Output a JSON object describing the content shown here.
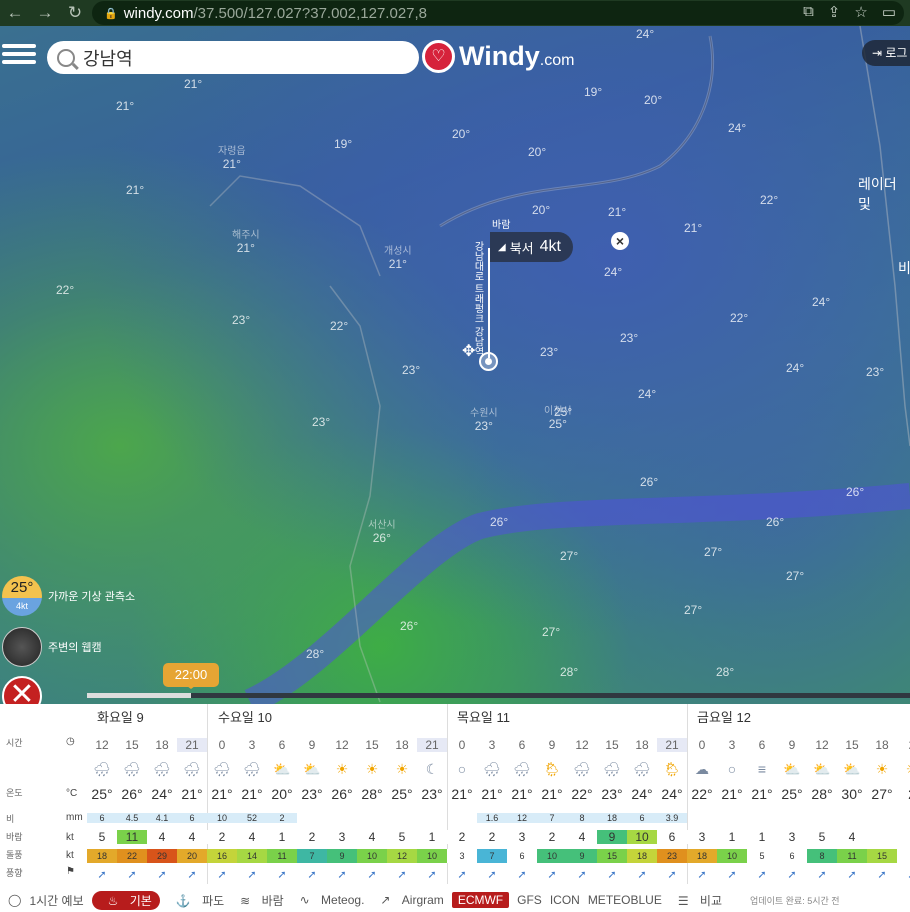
{
  "browser": {
    "url_domain": "windy.com",
    "url_path": "/37.500/127.027?37.002,127.027,8"
  },
  "search": {
    "value": "강남역"
  },
  "logo": {
    "brand": "Windy",
    "suffix": ".com"
  },
  "login": {
    "label": "로그"
  },
  "map": {
    "labels": [
      {
        "name": "",
        "temp": "24°"
      },
      {
        "name": "",
        "temp": "21°"
      },
      {
        "name": "",
        "temp": "21°"
      },
      {
        "name": "자령읍",
        "temp": "21°"
      },
      {
        "name": "",
        "temp": "21°"
      },
      {
        "name": "해주시",
        "temp": "21°"
      },
      {
        "name": "개성시",
        "temp": "21°"
      },
      {
        "name": "",
        "temp": "19°"
      },
      {
        "name": "",
        "temp": "20°"
      },
      {
        "name": "",
        "temp": "20°"
      },
      {
        "name": "",
        "temp": "20°"
      },
      {
        "name": "",
        "temp": "19°"
      },
      {
        "name": "",
        "temp": "20°"
      },
      {
        "name": "",
        "temp": "21°"
      },
      {
        "name": "",
        "temp": "24°"
      },
      {
        "name": "",
        "temp": "21°"
      },
      {
        "name": "",
        "temp": "22°"
      },
      {
        "name": "",
        "temp": "24°"
      },
      {
        "name": "",
        "temp": "22°"
      },
      {
        "name": "",
        "temp": "24°"
      },
      {
        "name": "",
        "temp": "23°"
      },
      {
        "name": "",
        "temp": "22°"
      },
      {
        "name": "",
        "temp": "23°"
      },
      {
        "name": "",
        "temp": "23°"
      },
      {
        "name": "",
        "temp": "25°"
      },
      {
        "name": "",
        "temp": "24°"
      },
      {
        "name": "",
        "temp": "23°"
      },
      {
        "name": "수원시",
        "temp": "23°"
      },
      {
        "name": "이천시",
        "temp": "25°"
      },
      {
        "name": "",
        "temp": "24°"
      },
      {
        "name": "",
        "temp": "23°"
      },
      {
        "name": "서산시",
        "temp": "26°"
      },
      {
        "name": "",
        "temp": "26°"
      },
      {
        "name": "",
        "temp": "26°"
      },
      {
        "name": "",
        "temp": "26°"
      },
      {
        "name": "",
        "temp": "27°"
      },
      {
        "name": "",
        "temp": "27°"
      },
      {
        "name": "",
        "temp": "26°"
      },
      {
        "name": "",
        "temp": "27°"
      },
      {
        "name": "",
        "temp": "28°"
      },
      {
        "name": "",
        "temp": "27°"
      },
      {
        "name": "",
        "temp": "28°"
      },
      {
        "name": "",
        "temp": "28°"
      },
      {
        "name": "",
        "temp": "27°"
      },
      {
        "name": "",
        "temp": "26°"
      },
      {
        "name": "",
        "temp": "23°"
      },
      {
        "name": "",
        "temp": "22°"
      }
    ],
    "radar_label": "레이더 및",
    "radar_label2": "비",
    "wind_tag": {
      "title": "바람",
      "direction": "북서",
      "speed": "4kt"
    },
    "pin_label": "강남대로 트래펑크 강남역",
    "station": {
      "temp": "25°",
      "wind": "4kt",
      "label": "가까운 기상 관측소"
    },
    "webcam": {
      "label": "주변의 웹캠"
    },
    "time_bubble": "22:00"
  },
  "forecast": {
    "days": [
      "화요일 9",
      "수요일 10",
      "목요일 11",
      "금요일 12"
    ],
    "row_labels": {
      "time": "시간",
      "temp": "온도",
      "rain": "비",
      "wind": "바람",
      "gust": "돌풍",
      "dir": "풍향"
    },
    "units": {
      "temp": "°C",
      "rain": "mm",
      "wind": "kt",
      "gust": "kt"
    },
    "hours": [
      "12",
      "15",
      "18",
      "21",
      "0",
      "3",
      "6",
      "9",
      "12",
      "15",
      "18",
      "21",
      "0",
      "3",
      "6",
      "9",
      "12",
      "15",
      "18",
      "21",
      "0",
      "3",
      "6",
      "9",
      "12",
      "15",
      "18",
      "2"
    ],
    "icons": [
      "rain",
      "rain",
      "rain",
      "rain",
      "rain",
      "rain",
      "sun-cloud",
      "sun-cloud",
      "sun",
      "sun",
      "sun",
      "moon",
      "moon-clear",
      "rain",
      "rain",
      "rain-sun",
      "rain",
      "rain",
      "rain",
      "rain-sun",
      "cloud-moon",
      "moon-clear",
      "fog",
      "sun-cloud",
      "sun-cloud",
      "sun-cloud",
      "sun",
      "sun"
    ],
    "temps": [
      "25°",
      "26°",
      "24°",
      "21°",
      "21°",
      "21°",
      "20°",
      "23°",
      "26°",
      "28°",
      "25°",
      "23°",
      "21°",
      "21°",
      "21°",
      "21°",
      "22°",
      "23°",
      "24°",
      "24°",
      "22°",
      "21°",
      "21°",
      "25°",
      "28°",
      "30°",
      "27°",
      "2"
    ],
    "rain": [
      "6",
      "4.5",
      "4.1",
      "6",
      "10",
      "52",
      "2",
      "",
      "",
      "",
      "",
      "",
      "",
      "1.6",
      "12",
      "7",
      "8",
      "18",
      "6",
      "3.9",
      "",
      "",
      "",
      "",
      "",
      "",
      "",
      ""
    ],
    "wind": [
      "5",
      "11",
      "4",
      "4",
      "2",
      "4",
      "1",
      "2",
      "3",
      "4",
      "5",
      "1",
      "2",
      "2",
      "3",
      "2",
      "4",
      "9",
      "10",
      "6",
      "3",
      "1",
      "1",
      "3",
      "5",
      "4",
      "",
      ""
    ],
    "gust": [
      "18",
      "22",
      "29",
      "20",
      "16",
      "14",
      "11",
      "7",
      "9",
      "10",
      "12",
      "10",
      "3",
      "7",
      "6",
      "10",
      "9",
      "15",
      "18",
      "23",
      "18",
      "10",
      "5",
      "6",
      "8",
      "11",
      "15",
      ""
    ],
    "gust_colors": [
      "#e3a92a",
      "#e0901e",
      "#d8541a",
      "#e3a92a",
      "#c4d43a",
      "#a6d843",
      "#7ad14a",
      "#3eb7a3",
      "#45c07a",
      "#7ad14a",
      "#a6d843",
      "#7ad14a",
      "#fff",
      "#49b5d6",
      "#fff",
      "#45c07a",
      "#45c07a",
      "#7ad14a",
      "#c4d43a",
      "#e0901e",
      "#e3a92a",
      "#7ad14a",
      "#fff",
      "#fff",
      "#45c07a",
      "#7ad14a",
      "#a6d843",
      "#fff"
    ],
    "wind_colors": [
      "#fff",
      "#7ad14a",
      "#fff",
      "#fff",
      "#fff",
      "#fff",
      "#fff",
      "#fff",
      "#fff",
      "#fff",
      "#fff",
      "#fff",
      "#fff",
      "#fff",
      "#fff",
      "#fff",
      "#fff",
      "#45c07a",
      "#a6d843",
      "#fff",
      "#fff",
      "#fff",
      "#fff",
      "#fff",
      "#fff",
      "#fff",
      "#fff",
      "#fff"
    ],
    "arrow": "➚"
  },
  "tabs": {
    "hourly": "1시간 예보",
    "basic": "기본",
    "waves": "파도",
    "wind": "바람",
    "meteog": "Meteog.",
    "airgram": "Airgram",
    "ecmwf": "ECMWF",
    "gfs": "GFS",
    "icon": "ICON",
    "meteoblue": "METEOBLUE",
    "compare": "비교",
    "updated": "업데이트 완료: 5시간 전"
  }
}
